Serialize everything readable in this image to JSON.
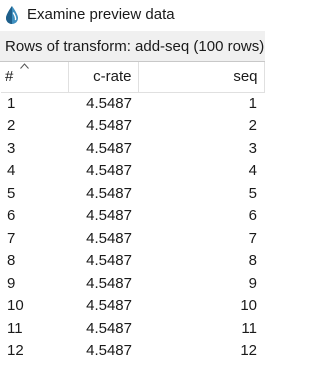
{
  "window": {
    "title": "Examine preview data",
    "icon": "droplet-icon",
    "accent_color": "#3f8fbf"
  },
  "subheader": {
    "text": "Rows of transform: add-seq (100 rows)"
  },
  "table": {
    "columns": [
      {
        "label": "#",
        "sort": "ascending"
      },
      {
        "label": "c-rate"
      },
      {
        "label": "seq"
      }
    ],
    "rows": [
      {
        "index": "1",
        "c_rate": "4.5487",
        "seq": "1"
      },
      {
        "index": "2",
        "c_rate": "4.5487",
        "seq": "2"
      },
      {
        "index": "3",
        "c_rate": "4.5487",
        "seq": "3"
      },
      {
        "index": "4",
        "c_rate": "4.5487",
        "seq": "4"
      },
      {
        "index": "5",
        "c_rate": "4.5487",
        "seq": "5"
      },
      {
        "index": "6",
        "c_rate": "4.5487",
        "seq": "6"
      },
      {
        "index": "7",
        "c_rate": "4.5487",
        "seq": "7"
      },
      {
        "index": "8",
        "c_rate": "4.5487",
        "seq": "8"
      },
      {
        "index": "9",
        "c_rate": "4.5487",
        "seq": "9"
      },
      {
        "index": "10",
        "c_rate": "4.5487",
        "seq": "10"
      },
      {
        "index": "11",
        "c_rate": "4.5487",
        "seq": "11"
      },
      {
        "index": "12",
        "c_rate": "4.5487",
        "seq": "12"
      }
    ]
  }
}
